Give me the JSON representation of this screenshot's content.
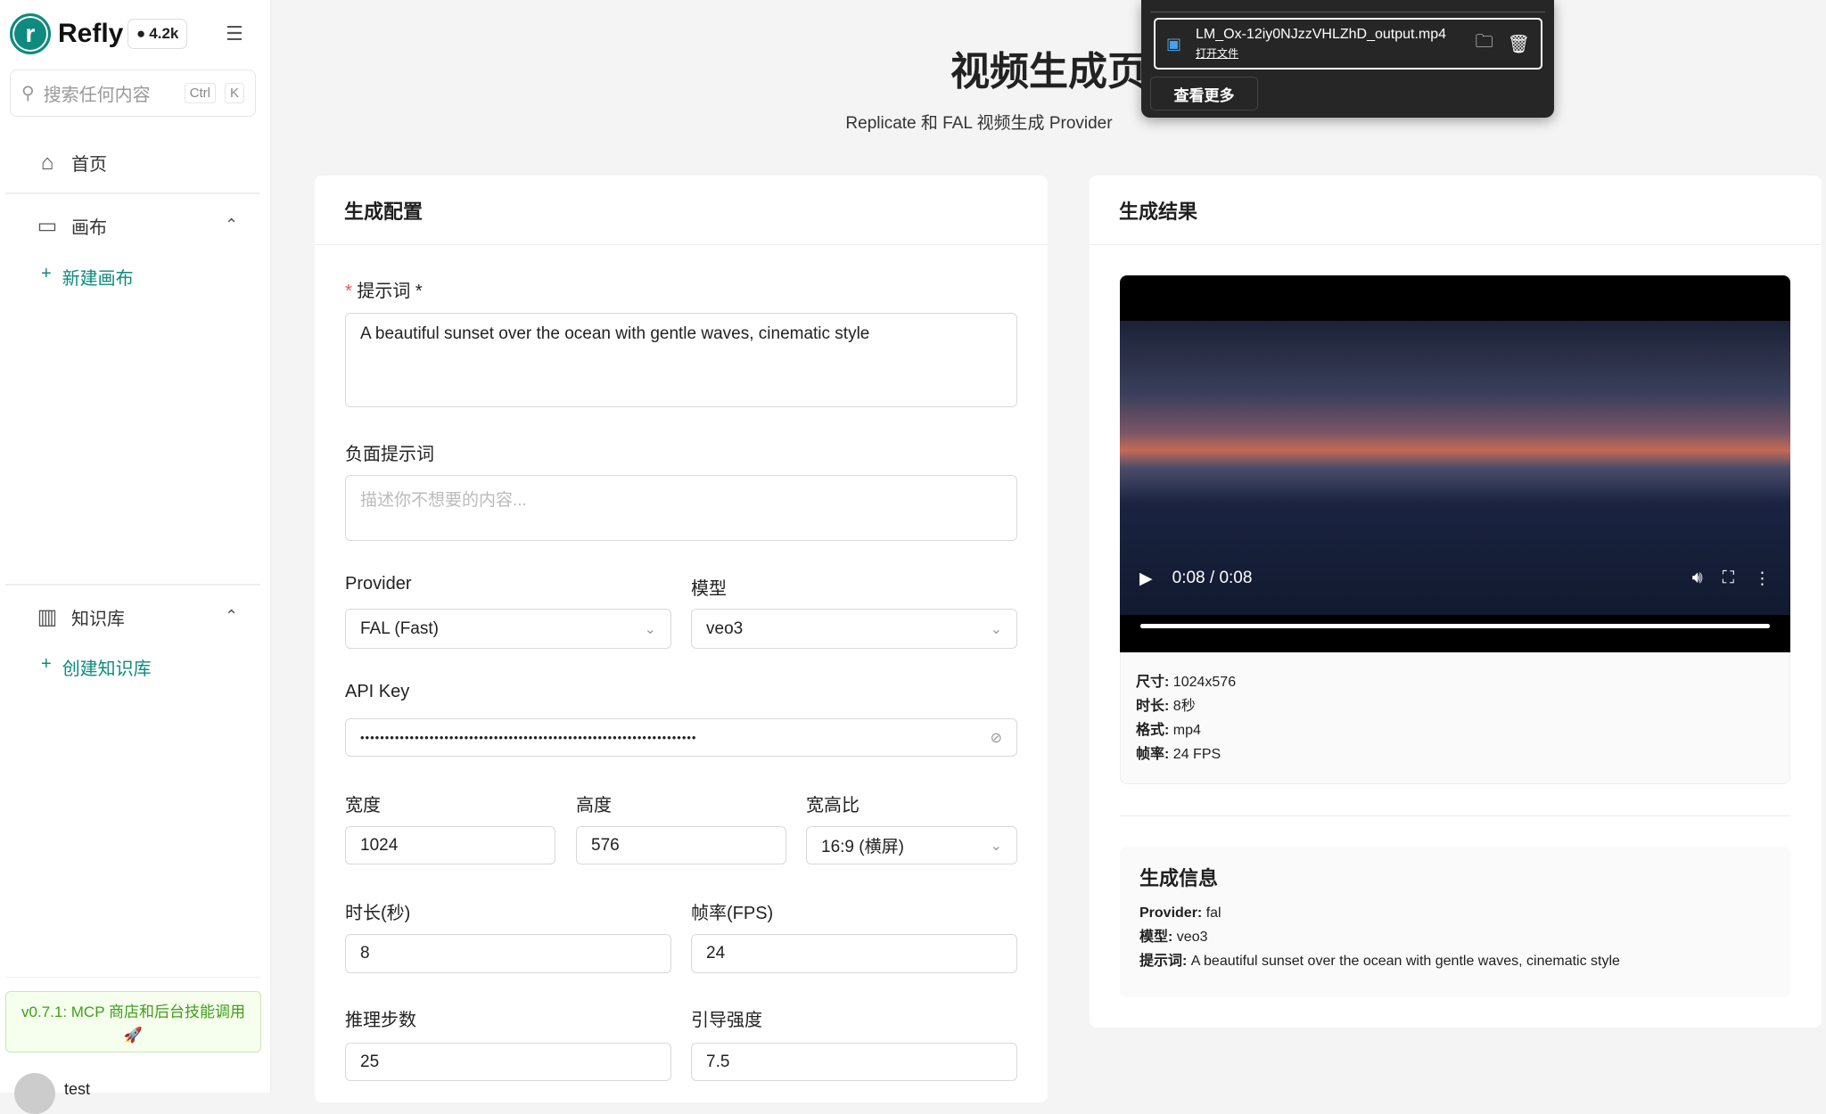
{
  "sidebar": {
    "brand": "Refly",
    "github_stars": "4.2k",
    "search_placeholder": "搜索任何内容",
    "kbd_ctrl": "Ctrl",
    "kbd_k": "K",
    "home": "首页",
    "canvas": "画布",
    "new_canvas": "新建画布",
    "knowledge": "知识库",
    "new_knowledge": "创建知识库",
    "banner": "v0.7.1: MCP 商店和后台技能调用",
    "banner_emoji": "🚀",
    "user": "test"
  },
  "header": {
    "title": "视频生成页",
    "subtitle": "Replicate 和 FAL 视频生成 Provider"
  },
  "config": {
    "title": "生成配置",
    "prompt_label": "提示词 *",
    "prompt_value": "A beautiful sunset over the ocean with gentle waves, cinematic style",
    "negative_label": "负面提示词",
    "negative_placeholder": "描述你不想要的内容...",
    "provider_label": "Provider",
    "provider_value": "FAL (Fast)",
    "model_label": "模型",
    "model_value": "veo3",
    "api_key_label": "API Key",
    "api_key_value": "••••••••••••••••••••••••••••••••••••••••••••••••••••••••••••••••••••",
    "width_label": "宽度",
    "width_value": "1024",
    "height_label": "高度",
    "height_value": "576",
    "aspect_label": "宽高比",
    "aspect_value": "16:9 (横屏)",
    "duration_label": "时长(秒)",
    "duration_value": "8",
    "fps_label": "帧率(FPS)",
    "fps_value": "24",
    "steps_label": "推理步数",
    "steps_value": "25",
    "guidance_label": "引导强度",
    "guidance_value": "7.5"
  },
  "result": {
    "title": "生成结果",
    "time": "0:08 / 0:08",
    "progress": 1.0,
    "size_label": "尺寸:",
    "size": "1024x576",
    "duration_label": "时长:",
    "duration": "8秒",
    "format_label": "格式:",
    "format": "mp4",
    "fps_label": "帧率:",
    "fps": "24 FPS",
    "info_title": "生成信息",
    "provider_label": "Provider:",
    "provider": "fal",
    "model_label": "模型:",
    "model": "veo3",
    "prompt_label": "提示词:",
    "prompt": "A beautiful sunset over the ocean with gentle waves, cinematic style"
  },
  "download": {
    "filename": "LM_Ox-12iy0NJzzVHLZhD_output.mp4",
    "open_file": "打开文件",
    "see_more": "查看更多"
  }
}
